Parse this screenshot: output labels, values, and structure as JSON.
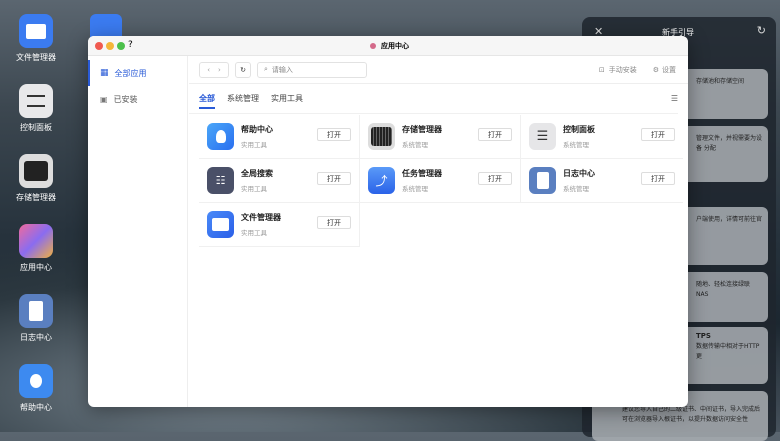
{
  "desktop": [
    {
      "label": "文件管理器"
    },
    {
      "label": "控制面板"
    },
    {
      "label": "存储管理器"
    },
    {
      "label": "应用中心"
    },
    {
      "label": "日志中心"
    },
    {
      "label": "帮助中心"
    }
  ],
  "guide": {
    "title": "新手引导",
    "cards": [
      {
        "text": "存储池和存储空间"
      },
      {
        "text": "管理文件，并视需要为设备 分配"
      },
      {
        "text": "户端使用，详情可前往官"
      },
      {
        "text": "随地、轻松连接绿联NAS"
      },
      {
        "title": "TPS",
        "text": "数据传输中相对于HTTP更"
      },
      {
        "text": "建议您导入自己的二级证书、中间证书，导入完成后可在浏览器导入根证书，以提升数据访问安全性"
      }
    ]
  },
  "window": {
    "title": "应用中心",
    "help": "?"
  },
  "sidebar": {
    "items": [
      {
        "label": "全部应用"
      },
      {
        "label": "已安装"
      }
    ]
  },
  "toolbar": {
    "search_placeholder": "请输入",
    "manual_install": "手动安装",
    "settings": "设置"
  },
  "tabs": [
    {
      "label": "全部"
    },
    {
      "label": "系统管理"
    },
    {
      "label": "实用工具"
    }
  ],
  "apps": [
    {
      "name": "帮助中心",
      "category": "实用工具",
      "action": "打开"
    },
    {
      "name": "存储管理器",
      "category": "系统管理",
      "action": "打开"
    },
    {
      "name": "控制面板",
      "category": "系统管理",
      "action": "打开"
    },
    {
      "name": "全局搜索",
      "category": "实用工具",
      "action": "打开"
    },
    {
      "name": "任务管理器",
      "category": "系统管理",
      "action": "打开"
    },
    {
      "name": "日志中心",
      "category": "系统管理",
      "action": "打开"
    },
    {
      "name": "文件管理器",
      "category": "实用工具",
      "action": "打开"
    }
  ],
  "colors": {
    "accent": "#2a5bd7"
  }
}
